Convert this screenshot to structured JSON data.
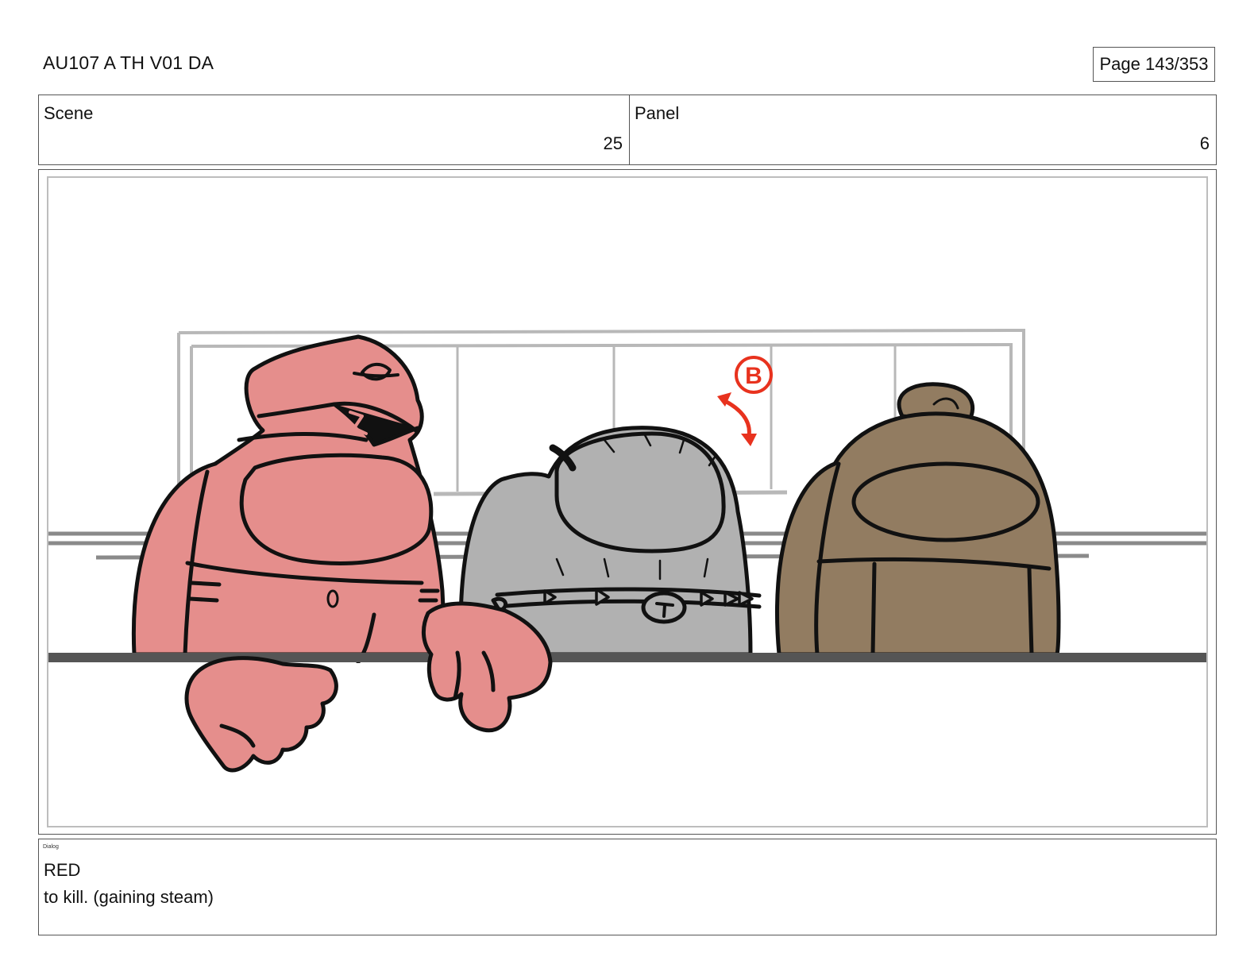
{
  "header": {
    "title": "AU107 A TH V01 DA",
    "page": "Page 143/353"
  },
  "info": {
    "scene_label": "Scene",
    "scene_value": "25",
    "panel_label": "Panel",
    "panel_value": "6"
  },
  "panel_art": {
    "characters": [
      {
        "name": "red",
        "color": "#e58e8c"
      },
      {
        "name": "gray",
        "color": "#b1b1b1"
      },
      {
        "name": "brown",
        "color": "#927c61"
      }
    ],
    "annotation_mark": "B",
    "annotation_color": "#e8321e"
  },
  "dialog": {
    "label": "Dialog",
    "speaker": "RED",
    "line": "to kill. (gaining steam)"
  }
}
